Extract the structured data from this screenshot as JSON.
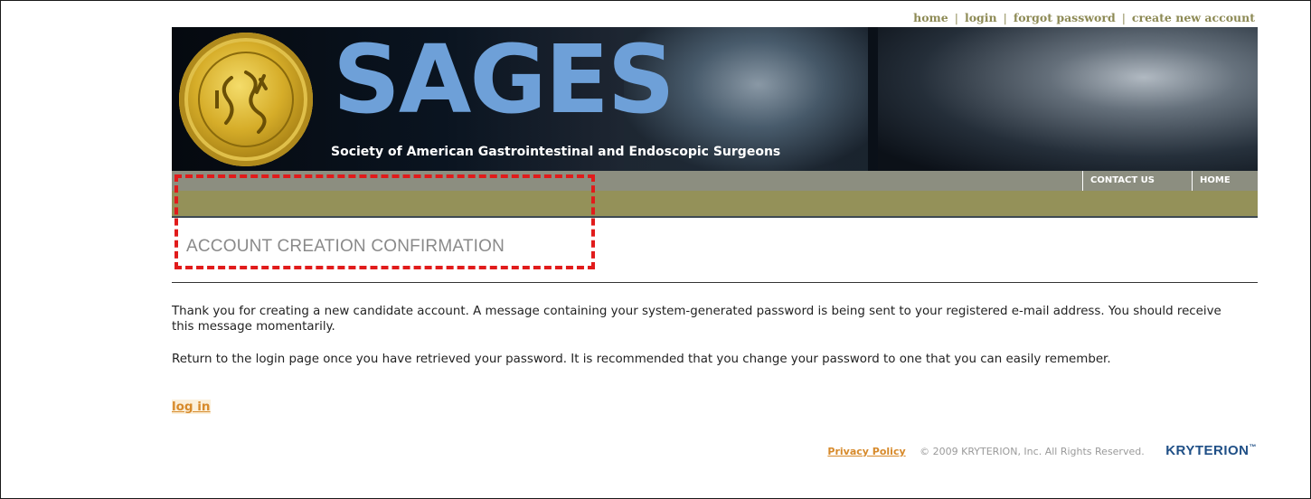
{
  "top_links": {
    "home": "home",
    "login": "login",
    "forgot_password": "forgot password",
    "create_account": "create new account",
    "separator": "|"
  },
  "banner": {
    "brand": "SAGES",
    "subtitle": "Society of American Gastrointestinal and Endoscopic Surgeons",
    "seal_text": "SOCIETY AMERICAN GASTROINTESTINAL ENDOSCOPIC SURGEONS SAGES"
  },
  "nav": {
    "contact_us": "CONTACT US",
    "home": "HOME"
  },
  "page": {
    "title": "ACCOUNT CREATION CONFIRMATION",
    "paragraph1": "Thank you for creating a new candidate account. A message containing your system-generated password is being sent to your registered e-mail address. You should receive this message momentarily.",
    "paragraph2": "Return to the login page once you have retrieved your password. It is recommended that you change your password to one that you can easily remember.",
    "login_link": "log in"
  },
  "footer": {
    "privacy_policy": "Privacy Policy",
    "copyright": "© 2009 KRYTERION, Inc. All Rights Reserved.",
    "logo": "KRYTERION",
    "logo_tm": "™"
  },
  "colors": {
    "highlight_border": "#e11b1b",
    "link_orange": "#d78a2b",
    "nav_olive": "#949159",
    "brand_blue": "#6ea0d8"
  }
}
